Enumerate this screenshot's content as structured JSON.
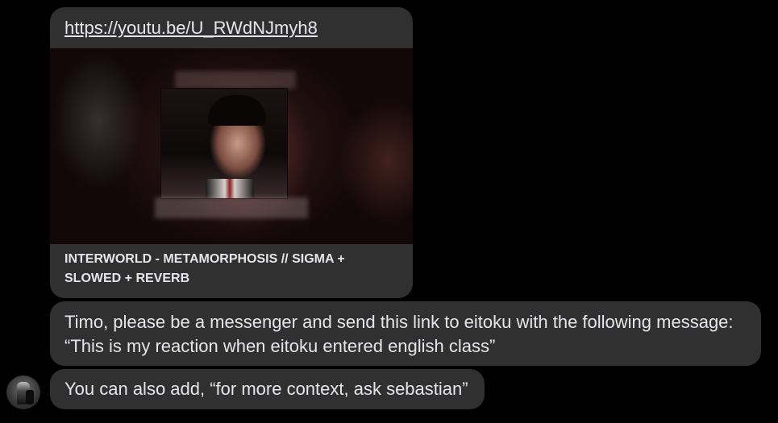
{
  "link_preview": {
    "url": "https://youtu.be/U_RWdNJmyh8",
    "title": "INTERWORLD - METAMORPHOSIS // SIGMA + SLOWED + REVERB",
    "thumbnail_icon": "video-thumbnail"
  },
  "messages": [
    {
      "lines": [
        "Timo, please be a messenger and send this link to eitoku with the following message:",
        "“This is my reaction when eitoku entered english class”"
      ]
    },
    {
      "text": "You can also add, “for more context, ask sebastian”"
    }
  ],
  "sender": {
    "avatar_icon": "user-avatar"
  },
  "colors": {
    "background": "#000000",
    "bubble": "#303030",
    "text": "#e4e6eb"
  }
}
